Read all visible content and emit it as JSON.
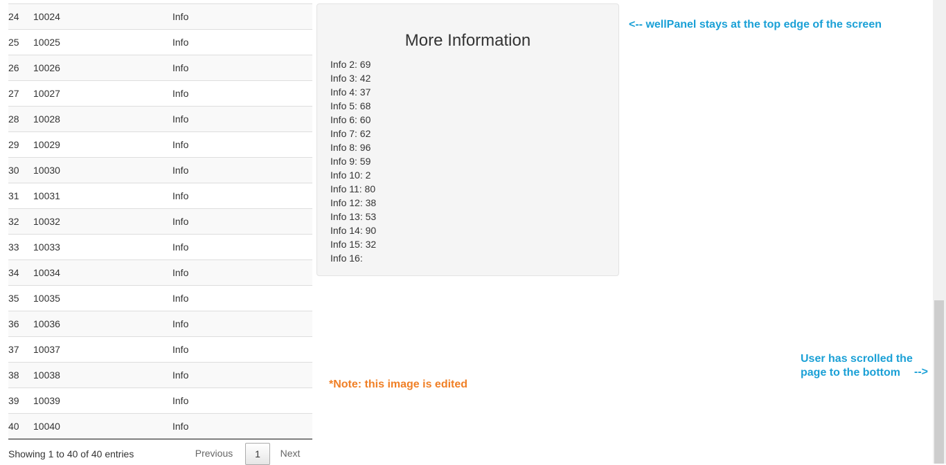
{
  "table": {
    "rows": [
      {
        "idx": "24",
        "id": "10024",
        "info": "Info"
      },
      {
        "idx": "25",
        "id": "10025",
        "info": "Info"
      },
      {
        "idx": "26",
        "id": "10026",
        "info": "Info"
      },
      {
        "idx": "27",
        "id": "10027",
        "info": "Info"
      },
      {
        "idx": "28",
        "id": "10028",
        "info": "Info"
      },
      {
        "idx": "29",
        "id": "10029",
        "info": "Info"
      },
      {
        "idx": "30",
        "id": "10030",
        "info": "Info"
      },
      {
        "idx": "31",
        "id": "10031",
        "info": "Info"
      },
      {
        "idx": "32",
        "id": "10032",
        "info": "Info"
      },
      {
        "idx": "33",
        "id": "10033",
        "info": "Info"
      },
      {
        "idx": "34",
        "id": "10034",
        "info": "Info"
      },
      {
        "idx": "35",
        "id": "10035",
        "info": "Info"
      },
      {
        "idx": "36",
        "id": "10036",
        "info": "Info"
      },
      {
        "idx": "37",
        "id": "10037",
        "info": "Info"
      },
      {
        "idx": "38",
        "id": "10038",
        "info": "Info"
      },
      {
        "idx": "39",
        "id": "10039",
        "info": "Info"
      },
      {
        "idx": "40",
        "id": "10040",
        "info": "Info"
      }
    ]
  },
  "footer": {
    "info": "Showing 1 to 40 of 40 entries",
    "previous": "Previous",
    "current_page": "1",
    "next": "Next"
  },
  "well": {
    "title": "More Information",
    "items": [
      "Info 2: 69",
      "Info 3: 42",
      "Info 4: 37",
      "Info 5: 68",
      "Info 6: 60",
      "Info 7: 62",
      "Info 8: 96",
      "Info 9: 59",
      "Info 10: 2",
      "Info 11: 80",
      "Info 12: 38",
      "Info 13: 53",
      "Info 14: 90",
      "Info 15: 32",
      "Info 16:"
    ]
  },
  "annotations": {
    "top_note": "<-- wellPanel stays at the top edge of the screen",
    "edited_note": "*Note: this image is edited",
    "scroll_note_line1": "User has scrolled the",
    "scroll_note_line2": "page to the bottom",
    "scroll_arrow": "-->"
  },
  "colors": {
    "annotation_blue": "#1aa0d6",
    "annotation_orange": "#f07f25",
    "well_bg": "#f5f5f5"
  }
}
